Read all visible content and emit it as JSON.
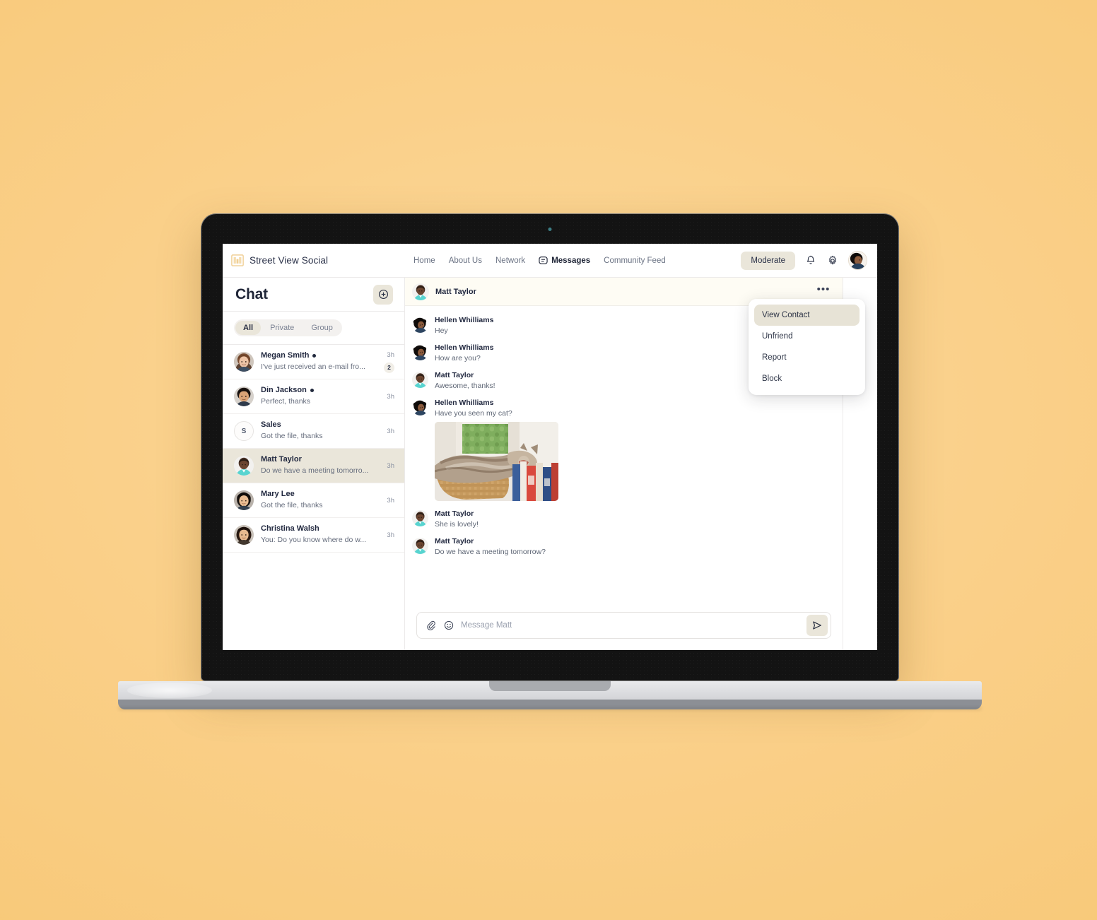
{
  "brand": {
    "name": "Street View Social",
    "logo_icon": "building-logo-icon",
    "logo_color": "#f5d9a8"
  },
  "topnav": {
    "links": [
      {
        "label": "Home",
        "active": false
      },
      {
        "label": "About Us",
        "active": false
      },
      {
        "label": "Network",
        "active": false
      },
      {
        "label": "Messages",
        "active": true,
        "icon": "chat-bubble-icon"
      },
      {
        "label": "Community Feed",
        "active": false
      }
    ],
    "moderate_label": "Moderate",
    "bell_icon": "bell-icon",
    "gear_icon": "gear-icon",
    "avatar_icon": "user-avatar"
  },
  "sidebar": {
    "title": "Chat",
    "new_chat_icon": "plus-circle-icon",
    "filters": [
      {
        "label": "All",
        "active": true
      },
      {
        "label": "Private",
        "active": false
      },
      {
        "label": "Group",
        "active": false
      }
    ],
    "conversations": [
      {
        "name": "Megan Smith",
        "online": true,
        "preview": "I've just received an e-mail fro...",
        "time": "3h",
        "unread": "2",
        "selected": false,
        "avatar_type": "photo",
        "avatar_kind": "woman-brown-hair"
      },
      {
        "name": "Din Jackson",
        "online": true,
        "preview": "Perfect, thanks",
        "time": "3h",
        "unread": "",
        "selected": false,
        "avatar_type": "photo",
        "avatar_kind": "man-dark-hair"
      },
      {
        "name": "Sales",
        "online": false,
        "preview": "Got the file, thanks",
        "time": "3h",
        "unread": "",
        "selected": false,
        "avatar_type": "letter",
        "avatar_letter": "S"
      },
      {
        "name": "Matt Taylor",
        "online": false,
        "preview": "Do we have a meeting tomorro...",
        "time": "3h",
        "unread": "",
        "selected": true,
        "avatar_type": "photo",
        "avatar_kind": "man-teal-shirt"
      },
      {
        "name": "Mary Lee",
        "online": false,
        "preview": "Got the file, thanks",
        "time": "3h",
        "unread": "",
        "selected": false,
        "avatar_type": "photo",
        "avatar_kind": "woman-black-bob"
      },
      {
        "name": "Christina Walsh",
        "online": false,
        "preview": "You: Do you know where do w...",
        "time": "3h",
        "unread": "",
        "selected": false,
        "avatar_type": "photo",
        "avatar_kind": "woman-dark-hair"
      }
    ]
  },
  "conversation": {
    "header": {
      "name": "Matt Taylor",
      "more_icon": "ellipsis-icon",
      "more_label": "•••"
    },
    "messages": [
      {
        "sender": "Hellen Whilliams",
        "text": "Hey",
        "avatar_kind": "woman-curly-hair",
        "photo": false
      },
      {
        "sender": "Hellen Whilliams",
        "text": "How are you?",
        "avatar_kind": "woman-curly-hair",
        "photo": false
      },
      {
        "sender": "Matt Taylor",
        "text": "Awesome, thanks!",
        "avatar_kind": "man-teal-shirt",
        "photo": false
      },
      {
        "sender": "Hellen Whilliams",
        "text": "Have you seen my cat?",
        "avatar_kind": "woman-curly-hair",
        "photo": true,
        "photo_alt": "cat-in-basket-photo"
      },
      {
        "sender": "Matt Taylor",
        "text": "She is lovely!",
        "avatar_kind": "man-teal-shirt",
        "photo": false
      },
      {
        "sender": "Matt Taylor",
        "text": "Do we have a meeting tomorrow?",
        "avatar_kind": "man-teal-shirt",
        "photo": false
      }
    ],
    "composer": {
      "placeholder": "Message Matt",
      "value": "",
      "attach_icon": "paperclip-icon",
      "emoji_icon": "smiley-icon",
      "send_icon": "send-icon"
    },
    "dropdown": [
      {
        "label": "View Contact",
        "active": true
      },
      {
        "label": "Unfriend",
        "active": false
      },
      {
        "label": "Report",
        "active": false
      },
      {
        "label": "Block",
        "active": false
      }
    ]
  },
  "colors": {
    "background": "#fad08a",
    "accent_tan": "#eae6da",
    "text_dark": "#222940",
    "text_muted": "#6b7384",
    "header_cream": "#fefcf4"
  }
}
